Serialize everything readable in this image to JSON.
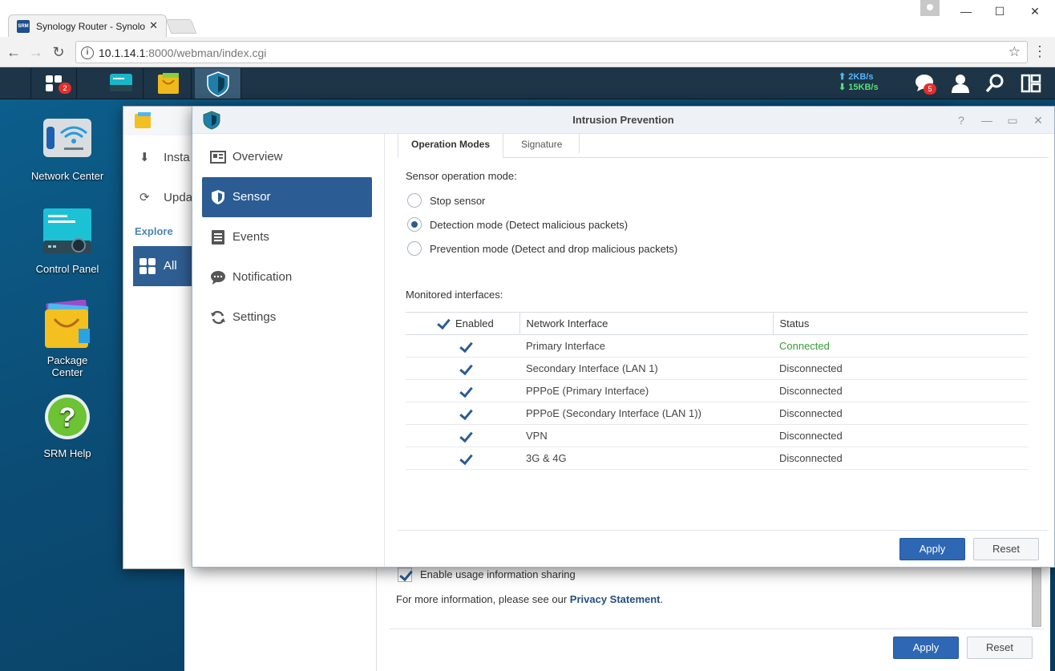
{
  "browser": {
    "tab_title": "Synology Router - Synolo",
    "tab_favicon": "SRM",
    "url_host": "10.1.14.1",
    "url_path": ":8000/webman/index.cgi"
  },
  "taskbar": {
    "apps_badge": "2",
    "upload_rate": "2KB/s",
    "download_rate": "15KB/s",
    "notifications_badge": "5"
  },
  "desktop": {
    "icons": [
      {
        "label": "Network Center",
        "icon": "wifi-router-icon"
      },
      {
        "label": "Control Panel",
        "icon": "control-panel-icon"
      },
      {
        "label": "Package Center",
        "icon": "shopping-bag-icon"
      },
      {
        "label": "SRM Help",
        "icon": "help-icon"
      }
    ]
  },
  "package_center": {
    "sidebar_install": "Insta",
    "sidebar_update": "Upda",
    "explore": "Explore",
    "all": "All",
    "usage_sharing": "Enable usage information sharing",
    "more_info_prefix": "For more information, please see our ",
    "privacy_link": "Privacy Statement",
    "more_info_suffix": ".",
    "apply": "Apply",
    "reset": "Reset"
  },
  "ips": {
    "title": "Intrusion Prevention",
    "nav": [
      {
        "label": "Overview",
        "icon": "overview-icon"
      },
      {
        "label": "Sensor",
        "icon": "shield-icon"
      },
      {
        "label": "Events",
        "icon": "list-icon"
      },
      {
        "label": "Notification",
        "icon": "chat-bubble-icon"
      },
      {
        "label": "Settings",
        "icon": "refresh-icon"
      }
    ],
    "active_nav": "Sensor",
    "tabs": [
      "Operation Modes",
      "Signature"
    ],
    "active_tab": "Operation Modes",
    "sensor_mode_label": "Sensor operation mode:",
    "modes": [
      {
        "label": "Stop sensor",
        "selected": false
      },
      {
        "label": "Detection mode (Detect malicious packets)",
        "selected": true
      },
      {
        "label": "Prevention mode (Detect and drop malicious packets)",
        "selected": false
      }
    ],
    "monitored_label": "Monitored interfaces:",
    "columns": [
      "Enabled",
      "Network Interface",
      "Status"
    ],
    "interfaces": [
      {
        "enabled": true,
        "name": "Primary Interface",
        "status": "Connected"
      },
      {
        "enabled": true,
        "name": "Secondary Interface (LAN 1)",
        "status": "Disconnected"
      },
      {
        "enabled": true,
        "name": "PPPoE (Primary Interface)",
        "status": "Disconnected"
      },
      {
        "enabled": true,
        "name": "PPPoE (Secondary Interface (LAN 1))",
        "status": "Disconnected"
      },
      {
        "enabled": true,
        "name": "VPN",
        "status": "Disconnected"
      },
      {
        "enabled": true,
        "name": "3G & 4G",
        "status": "Disconnected"
      }
    ],
    "apply": "Apply",
    "reset": "Reset"
  },
  "colors": {
    "accent": "#2b5c93",
    "connected": "#3a9a3a",
    "taskbar": "#1d3547"
  }
}
